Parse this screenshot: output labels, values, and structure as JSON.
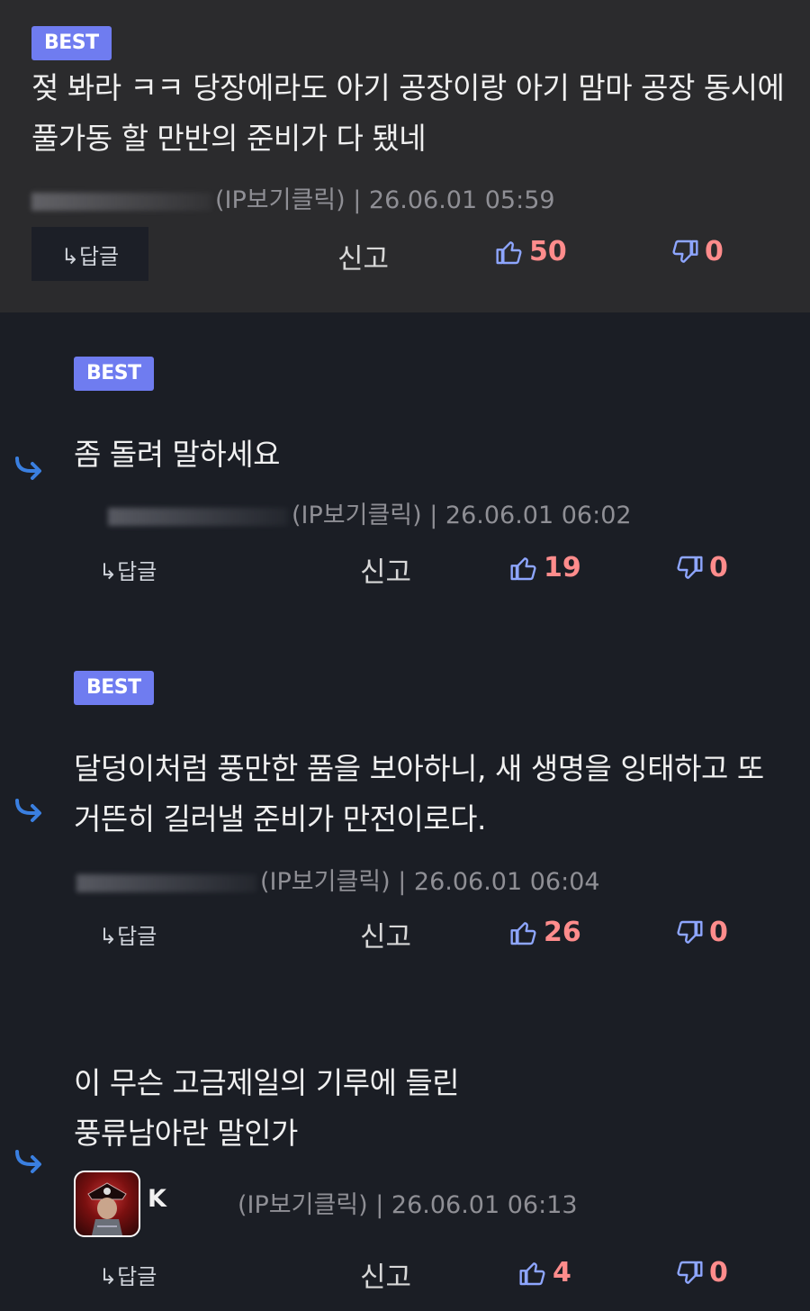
{
  "common": {
    "reply_label": "↳답글",
    "report_label": "신고",
    "best_label": "BEST"
  },
  "colors": {
    "badge": "#6f7cf0",
    "vote": "#ff8c8c",
    "reply_arrow": "#3a7fe0",
    "vote_icon": "#8ea6ff"
  },
  "comments": [
    {
      "content": "젖 봐라 ㅋㅋ 당장에라도 아기 공장이랑 아기 맘마 공장 동시에 풀가동 할 만반의 준비가 다 됐네",
      "meta": "(IP보기클릭) | 26.06.01 05:59",
      "likes": "50",
      "dislikes": "0"
    },
    {
      "content": "좀 돌려 말하세요",
      "meta": "(IP보기클릭) | 26.06.01 06:02",
      "likes": "19",
      "dislikes": "0"
    },
    {
      "content": "달덩이처럼 풍만한 품을 보아하니, 새 생명을 잉태하고 또 거뜬히 길러낼 준비가 만전이로다.",
      "meta": "(IP보기클릭) | 26.06.01 06:04",
      "likes": "26",
      "dislikes": "0"
    },
    {
      "content_line1": "이 무슨 고금제일의 기루에 들린",
      "content_line2": "풍류남아란 말인가",
      "nick": "K",
      "meta": "(IP보기클릭) | 26.06.01 06:13",
      "likes": "4",
      "dislikes": "0"
    }
  ]
}
